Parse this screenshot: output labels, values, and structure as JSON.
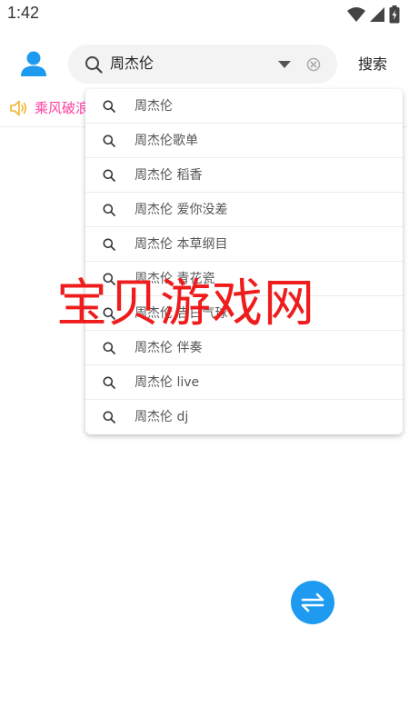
{
  "status_bar": {
    "time": "1:42"
  },
  "header": {
    "search_value": "周杰伦",
    "search_button_label": "搜索"
  },
  "announcement": {
    "text": "乘风破浪"
  },
  "suggestions": [
    {
      "label": "周杰伦"
    },
    {
      "label": "周杰伦歌单"
    },
    {
      "label": "周杰伦 稻香"
    },
    {
      "label": "周杰伦 爱你没差"
    },
    {
      "label": "周杰伦 本草纲目"
    },
    {
      "label": "周杰伦 青花瓷"
    },
    {
      "label": "周杰伦 告白气球"
    },
    {
      "label": "周杰伦 伴奏"
    },
    {
      "label": "周杰伦 live"
    },
    {
      "label": "周杰伦 dj"
    }
  ],
  "watermark": {
    "text": "宝贝游戏网"
  },
  "icons": {
    "avatar": "user-icon",
    "search": "search-icon",
    "dropdown": "chevron-down-icon",
    "clear": "clear-icon",
    "speaker": "speaker-icon",
    "fab": "swap-icon",
    "wifi": "wifi-icon",
    "signal": "signal-icon",
    "battery": "battery-icon"
  },
  "colors": {
    "accent": "#1e9bf0",
    "announcement": "#ff3fa0",
    "watermark": "#ee1c1c",
    "speaker": "#f0b429"
  }
}
